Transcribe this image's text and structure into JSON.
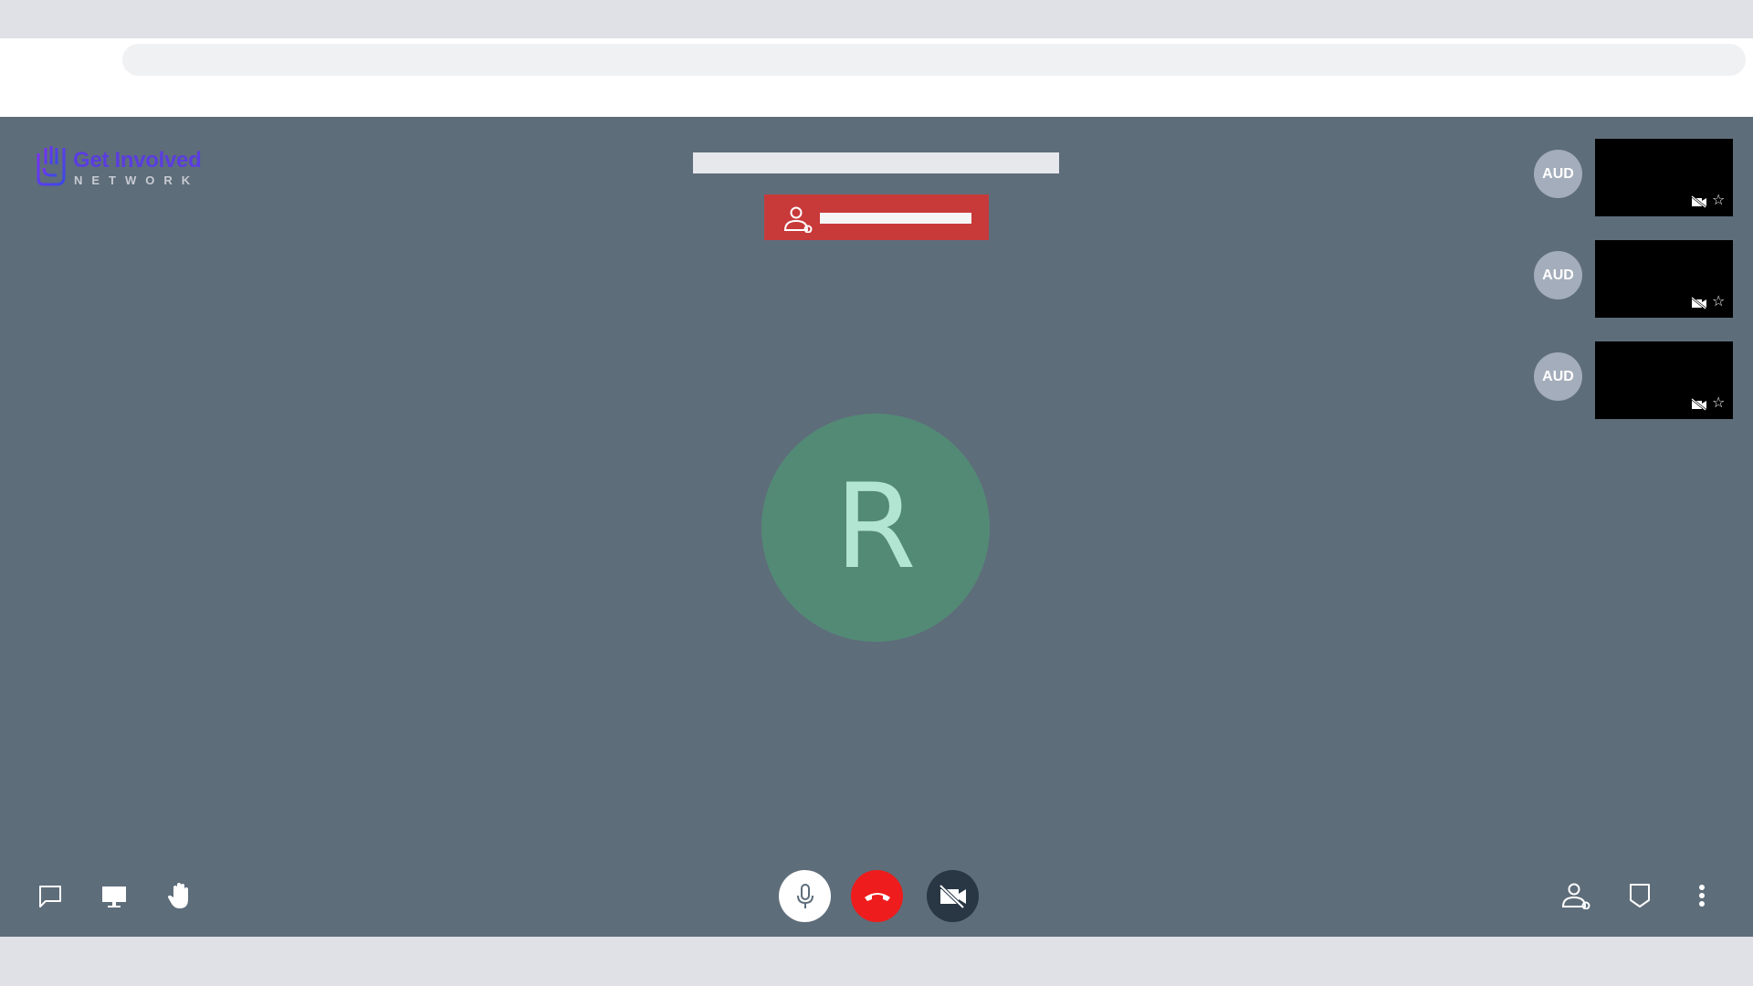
{
  "branding": {
    "title": "Get Involved",
    "subtitle": "NETWORK"
  },
  "main": {
    "speaker_initial": "R"
  },
  "participants": [
    {
      "label": "AUD"
    },
    {
      "label": "AUD"
    },
    {
      "label": "AUD"
    }
  ],
  "toolbar": {
    "left": [
      "chat-icon",
      "screen-share-icon",
      "raise-hand-icon"
    ],
    "center": [
      "microphone-icon",
      "hang-up-icon",
      "camera-off-icon"
    ],
    "right": [
      "participants-icon",
      "security-shield-icon",
      "more-options-icon"
    ]
  },
  "colors": {
    "stage": "#5e6d7a",
    "recording": "#c8393a",
    "hangup": "#ee1c1c",
    "avatar": "#538a76",
    "brand": "#5a3de0"
  }
}
